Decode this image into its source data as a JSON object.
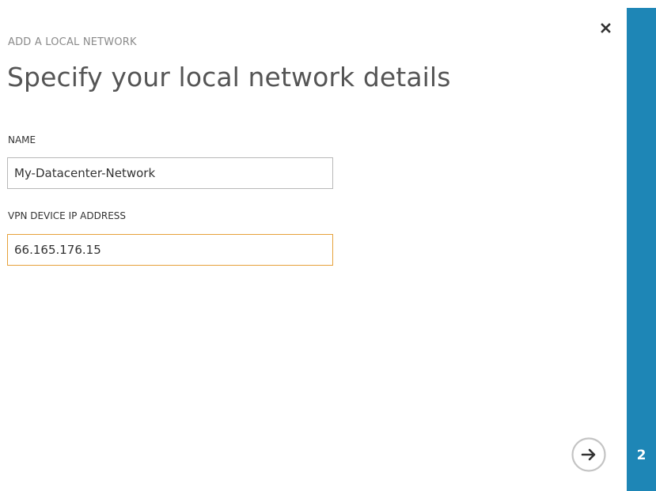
{
  "dialog": {
    "subtitle": "ADD A LOCAL NETWORK",
    "title": "Specify your local network details"
  },
  "form": {
    "name": {
      "label": "NAME",
      "value": "My-Datacenter-Network"
    },
    "vpn_device_ip": {
      "label": "VPN DEVICE IP ADDRESS",
      "value": "66.165.176.15"
    }
  },
  "wizard": {
    "current_step": "2"
  },
  "icons": {
    "close": "close-icon",
    "next": "arrow-right-circle-icon"
  },
  "colors": {
    "accent": "#1e86b6",
    "focus_border": "#e6a13a",
    "title_text": "#555555",
    "subtitle_text": "#8a8a8a"
  }
}
